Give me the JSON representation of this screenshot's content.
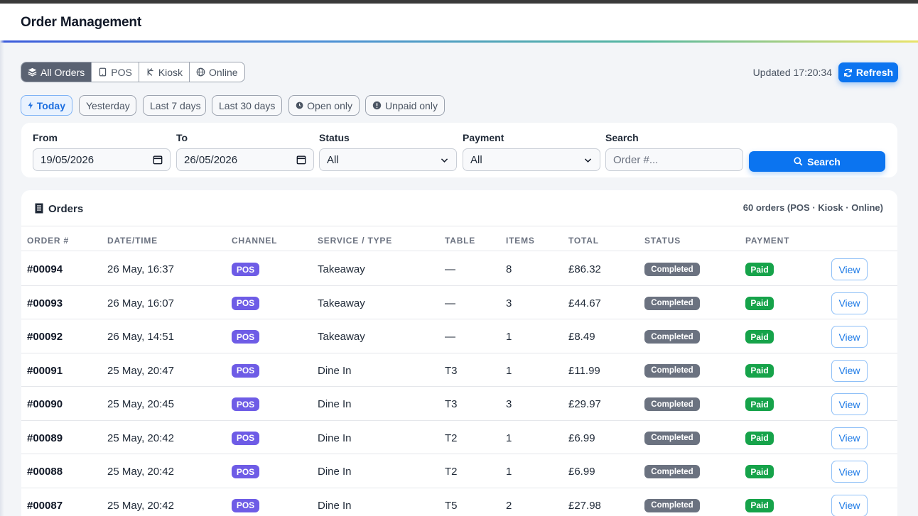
{
  "header": {
    "title": "Order Management"
  },
  "channels": [
    {
      "label": "All Orders",
      "icon": "layers-icon",
      "active": true
    },
    {
      "label": "POS",
      "icon": "tablet-icon",
      "active": false
    },
    {
      "label": "Kiosk",
      "icon": "kiosk-icon",
      "active": false
    },
    {
      "label": "Online",
      "icon": "globe-icon",
      "active": false
    }
  ],
  "status_bar": {
    "updated": "Updated 17:20:34",
    "refresh_label": "Refresh"
  },
  "quick_filters": [
    {
      "label": "Today",
      "icon": "bolt-icon",
      "active": true
    },
    {
      "label": "Yesterday"
    },
    {
      "label": "Last 7 days"
    },
    {
      "label": "Last 30 days"
    },
    {
      "label": "Open only",
      "icon": "clock-icon"
    },
    {
      "label": "Unpaid only",
      "icon": "alert-icon"
    }
  ],
  "filters": {
    "from_label": "From",
    "from_value": "19/05/2026",
    "to_label": "To",
    "to_value": "26/05/2026",
    "status_label": "Status",
    "status_value": "All",
    "payment_label": "Payment",
    "payment_value": "All",
    "search_label": "Search",
    "search_placeholder": "Order #...",
    "search_button": "Search"
  },
  "orders": {
    "title": "Orders",
    "count": "60 orders (POS · Kiosk · Online)",
    "columns": [
      "ORDER #",
      "DATE/TIME",
      "CHANNEL",
      "SERVICE / TYPE",
      "TABLE",
      "ITEMS",
      "TOTAL",
      "STATUS",
      "PAYMENT"
    ],
    "rows": [
      {
        "order": "#00094",
        "datetime": "26 May, 16:37",
        "channel": "POS",
        "service": "Takeaway",
        "table": "—",
        "items": "8",
        "total": "£86.32",
        "status": "Completed",
        "payment": "Paid",
        "action": "View"
      },
      {
        "order": "#00093",
        "datetime": "26 May, 16:07",
        "channel": "POS",
        "service": "Takeaway",
        "table": "—",
        "items": "3",
        "total": "£44.67",
        "status": "Completed",
        "payment": "Paid",
        "action": "View"
      },
      {
        "order": "#00092",
        "datetime": "26 May, 14:51",
        "channel": "POS",
        "service": "Takeaway",
        "table": "—",
        "items": "1",
        "total": "£8.49",
        "status": "Completed",
        "payment": "Paid",
        "action": "View"
      },
      {
        "order": "#00091",
        "datetime": "25 May, 20:47",
        "channel": "POS",
        "service": "Dine In",
        "table": "T3",
        "items": "1",
        "total": "£11.99",
        "status": "Completed",
        "payment": "Paid",
        "action": "View"
      },
      {
        "order": "#00090",
        "datetime": "25 May, 20:45",
        "channel": "POS",
        "service": "Dine In",
        "table": "T3",
        "items": "3",
        "total": "£29.97",
        "status": "Completed",
        "payment": "Paid",
        "action": "View"
      },
      {
        "order": "#00089",
        "datetime": "25 May, 20:42",
        "channel": "POS",
        "service": "Dine In",
        "table": "T2",
        "items": "1",
        "total": "£6.99",
        "status": "Completed",
        "payment": "Paid",
        "action": "View"
      },
      {
        "order": "#00088",
        "datetime": "25 May, 20:42",
        "channel": "POS",
        "service": "Dine In",
        "table": "T2",
        "items": "1",
        "total": "£6.99",
        "status": "Completed",
        "payment": "Paid",
        "action": "View"
      },
      {
        "order": "#00087",
        "datetime": "25 May, 20:42",
        "channel": "POS",
        "service": "Dine In",
        "table": "T5",
        "items": "2",
        "total": "£27.98",
        "status": "Completed",
        "payment": "Paid",
        "action": "View"
      }
    ]
  },
  "colors": {
    "accent": "#0b74f0",
    "pos_badge": "#6e5ce6",
    "status_badge": "#6b7280",
    "paid_badge": "#16a34a"
  }
}
